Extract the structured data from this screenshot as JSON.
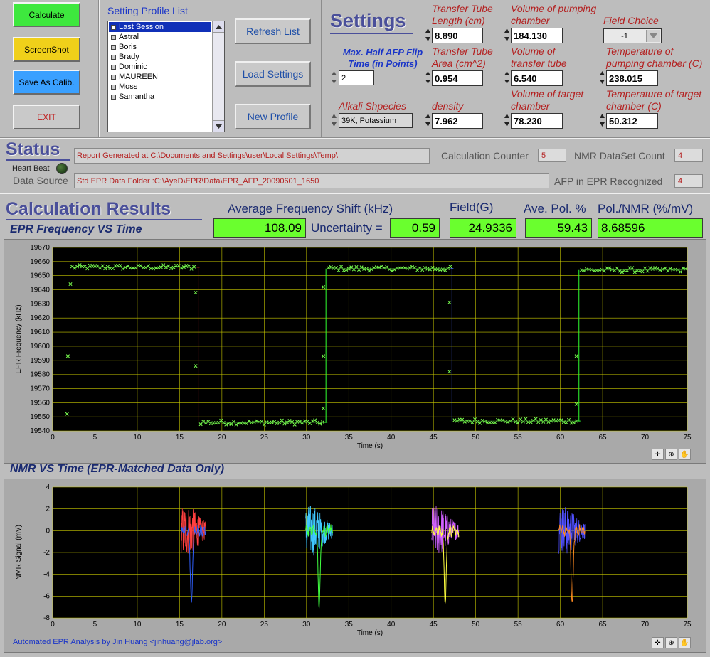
{
  "buttons": {
    "calculate": "Calculate",
    "screenshot": "ScreenShot",
    "save_calib": "Save As Calib.",
    "exit": "EXIT",
    "refresh": "Refresh List",
    "load": "Load Settings",
    "new_profile": "New Profile"
  },
  "profile_list": {
    "title": "Setting Profile List",
    "items": [
      "Last Session",
      "Astral",
      "Boris",
      "Brady",
      "Dominic",
      "MAUREEN",
      "Moss",
      "Samantha"
    ]
  },
  "settings": {
    "title": "Settings",
    "max_half_afp_label": "Max. Half AFP Flip Time (in Points)",
    "max_half_afp_value": "2",
    "alkali_label": "Alkali Shpecies",
    "alkali_value": "39K, Potassium",
    "tt_length_label": "Transfer Tube Length (cm)",
    "tt_length_value": "8.890",
    "tt_area_label": "Transfer Tube Area (cm^2)",
    "tt_area_value": "0.954",
    "density_label": "density",
    "density_value": "7.962",
    "vol_pump_label": "Volume of pumping chamber",
    "vol_pump_value": "184.130",
    "vol_tt_label": "Volume of transfer tube",
    "vol_tt_value": "6.540",
    "vol_target_label": "Volume of target chamber",
    "vol_target_value": "78.230",
    "field_choice_label": "Field Choice",
    "field_choice_value": "-1",
    "temp_pump_label": "Temperature of pumping chamber (C)",
    "temp_pump_value": "238.015",
    "temp_target_label": "Temperature of target chamber (C)",
    "temp_target_value": "50.312"
  },
  "status": {
    "title": "Status",
    "report": "Report Generated at C:\\Documents and Settings\\user\\Local Settings\\Temp\\",
    "heartbeat_label": "Heart Beat",
    "data_source_label": "Data Source",
    "data_source_value": "Std EPR Data Folder :C:\\AyeD\\EPR\\Data\\EPR_AFP_20090601_1650",
    "calc_counter_label": "Calculation Counter",
    "calc_counter_value": "5",
    "nmr_count_label": "NMR DataSet Count",
    "nmr_count_value": "4",
    "afp_label": "AFP in EPR Recognized",
    "afp_value": "4"
  },
  "results": {
    "title": "Calculation Results",
    "avg_shift_label": "Average Frequency Shift (kHz)",
    "avg_shift_value": "108.09",
    "uncertainty_label": "Uncertainty =",
    "uncertainty_value": "0.59",
    "field_label": "Field(G)",
    "field_value": "24.9336",
    "ave_pol_label": "Ave. Pol. %",
    "ave_pol_value": "59.43",
    "pol_nmr_label": "Pol./NMR (%/mV)",
    "pol_nmr_value": "8.68596"
  },
  "footer_credit": "Automated EPR Analysis by Jin Huang <jinhuang@jlab.org>",
  "colors": {
    "green": "#6aff2e",
    "plot_bg": "#000000",
    "grid": "#c8c800",
    "accent": "#4a4f9a",
    "label_red": "#b42020"
  },
  "chart_data": [
    {
      "type": "scatter",
      "title": "EPR Frequency VS Time",
      "xlabel": "Time (s)",
      "ylabel": "EPR Frequency (kHz)",
      "xlim": [
        0,
        75
      ],
      "ylim": [
        19540,
        19670
      ],
      "xticks": [
        0,
        5,
        10,
        15,
        20,
        25,
        30,
        35,
        40,
        45,
        50,
        55,
        60,
        65,
        70,
        75
      ],
      "yticks": [
        19540,
        19550,
        19560,
        19570,
        19580,
        19590,
        19600,
        19610,
        19620,
        19630,
        19640,
        19650,
        19660,
        19670
      ],
      "segments": [
        {
          "x_start": 2,
          "x_end": 17.2,
          "level": 19656
        },
        {
          "x_start": 17.2,
          "x_end": 32.3,
          "level": 19546
        },
        {
          "x_start": 32.3,
          "x_end": 47.2,
          "level": 19655
        },
        {
          "x_start": 47.2,
          "x_end": 62.2,
          "level": 19547
        },
        {
          "x_start": 62.2,
          "x_end": 75,
          "level": 19654
        }
      ],
      "transitions": [
        {
          "x": 17.2,
          "color": "#ff3030",
          "points": [
            19638,
            19586
          ]
        },
        {
          "x": 32.3,
          "color": "#30ff30",
          "points": [
            19642,
            19593,
            19556
          ]
        },
        {
          "x": 47.2,
          "color": "#4a6aff",
          "points": [
            19631,
            19582
          ]
        },
        {
          "x": 62.2,
          "color": "#30ff30",
          "points": [
            19593,
            19559
          ]
        }
      ],
      "outliers": [
        [
          1.7,
          19552
        ],
        [
          1.8,
          19593
        ],
        [
          2.1,
          19644
        ]
      ]
    },
    {
      "type": "line",
      "title": "NMR VS Time (EPR-Matched Data Only)",
      "xlabel": "Time (s)",
      "ylabel": "NMR Signal (mV)",
      "xlim": [
        0,
        75
      ],
      "ylim": [
        -8,
        4
      ],
      "xticks": [
        0,
        5,
        10,
        15,
        20,
        25,
        30,
        35,
        40,
        45,
        50,
        55,
        60,
        65,
        70,
        75
      ],
      "yticks": [
        -8,
        -6,
        -4,
        -2,
        0,
        2,
        4
      ],
      "bursts": [
        {
          "x_start": 15.2,
          "x_end": 18.1,
          "dip_x": 16.4,
          "dip": -6.6,
          "color_a": "#ff4040",
          "color_b": "#3060ff"
        },
        {
          "x_start": 29.9,
          "x_end": 33.1,
          "dip_x": 31.5,
          "dip": -6.8,
          "color_a": "#40c8ff",
          "color_b": "#40ff40"
        },
        {
          "x_start": 44.8,
          "x_end": 48.0,
          "dip_x": 46.4,
          "dip": -6.5,
          "color_a": "#d060ff",
          "color_b": "#ffff40"
        },
        {
          "x_start": 59.8,
          "x_end": 62.9,
          "dip_x": 61.4,
          "dip": -6.6,
          "color_a": "#5050ff",
          "color_b": "#ff8a20"
        }
      ]
    }
  ]
}
